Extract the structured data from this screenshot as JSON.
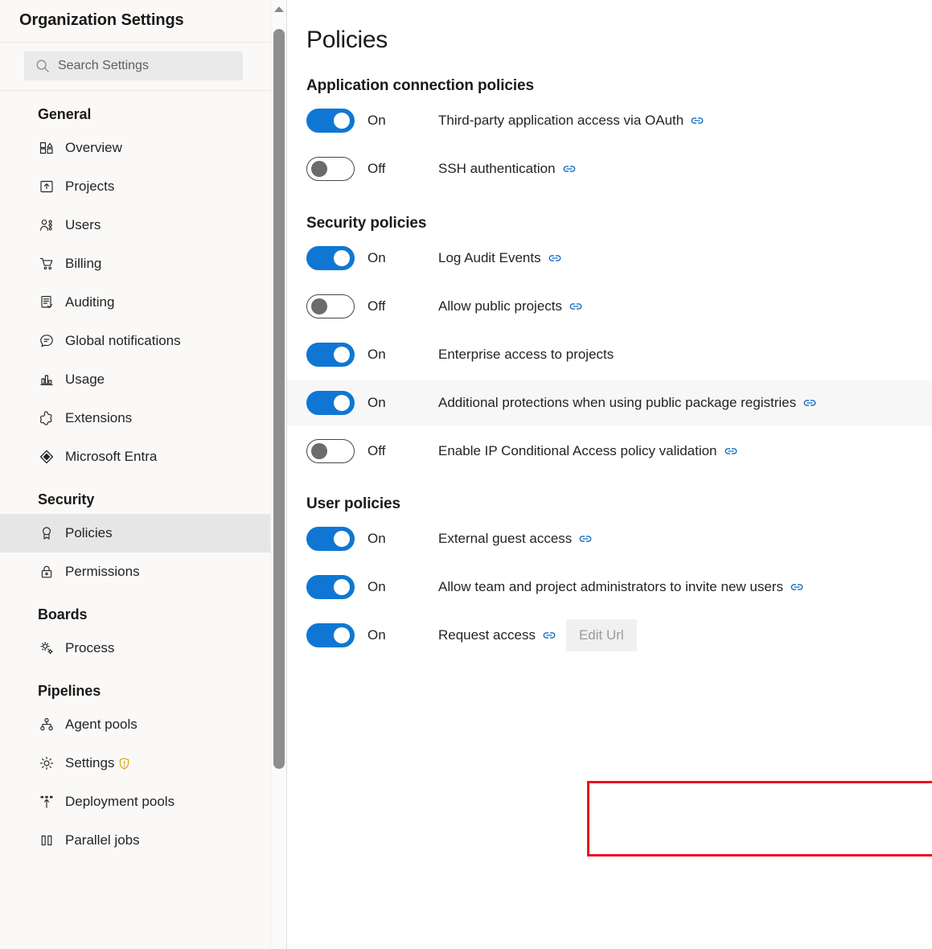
{
  "colors": {
    "accent_blue": "#0f77d3",
    "link_blue": "#0f6cbd",
    "highlight_red": "#e81123",
    "warning_amber": "#d9a300",
    "sidebar_bg": "#faf9f8",
    "selected_bg": "#e6e6e6",
    "hover_row_bg": "#f7f7f7"
  },
  "sidebar": {
    "title": "Organization Settings",
    "search": {
      "placeholder": "Search Settings",
      "value": "",
      "icon": "search-icon"
    },
    "groups": [
      {
        "title": "General",
        "items": [
          {
            "label": "Overview",
            "icon": "overview-icon",
            "selected": false,
            "badge": null
          },
          {
            "label": "Projects",
            "icon": "projects-icon",
            "selected": false,
            "badge": null
          },
          {
            "label": "Users",
            "icon": "users-icon",
            "selected": false,
            "badge": null
          },
          {
            "label": "Billing",
            "icon": "billing-cart-icon",
            "selected": false,
            "badge": null
          },
          {
            "label": "Auditing",
            "icon": "auditing-icon",
            "selected": false,
            "badge": null
          },
          {
            "label": "Global notifications",
            "icon": "notifications-icon",
            "selected": false,
            "badge": null
          },
          {
            "label": "Usage",
            "icon": "usage-chart-icon",
            "selected": false,
            "badge": null
          },
          {
            "label": "Extensions",
            "icon": "extensions-icon",
            "selected": false,
            "badge": null
          },
          {
            "label": "Microsoft Entra",
            "icon": "entra-icon",
            "selected": false,
            "badge": null
          }
        ]
      },
      {
        "title": "Security",
        "items": [
          {
            "label": "Policies",
            "icon": "policies-ribbon-icon",
            "selected": true,
            "badge": null
          },
          {
            "label": "Permissions",
            "icon": "lock-icon",
            "selected": false,
            "badge": null
          }
        ]
      },
      {
        "title": "Boards",
        "items": [
          {
            "label": "Process",
            "icon": "process-gears-icon",
            "selected": false,
            "badge": null
          }
        ]
      },
      {
        "title": "Pipelines",
        "items": [
          {
            "label": "Agent pools",
            "icon": "agent-pools-icon",
            "selected": false,
            "badge": null
          },
          {
            "label": "Settings",
            "icon": "gear-icon",
            "selected": false,
            "badge": "warning-shield-icon"
          },
          {
            "label": "Deployment pools",
            "icon": "deployment-pools-icon",
            "selected": false,
            "badge": null
          },
          {
            "label": "Parallel jobs",
            "icon": "parallel-jobs-icon",
            "selected": false,
            "badge": null
          }
        ]
      }
    ]
  },
  "main": {
    "page_title": "Policies",
    "sections": [
      {
        "title": "Application connection policies",
        "policies": [
          {
            "state": "On",
            "on": true,
            "label": "Third-party application access via OAuth",
            "has_link": true,
            "link_icon": "link-icon",
            "hovered": false,
            "button": null,
            "highlighted": false
          },
          {
            "state": "Off",
            "on": false,
            "label": "SSH authentication",
            "has_link": true,
            "link_icon": "link-icon",
            "hovered": false,
            "button": null,
            "highlighted": false
          }
        ]
      },
      {
        "title": "Security policies",
        "policies": [
          {
            "state": "On",
            "on": true,
            "label": "Log Audit Events",
            "has_link": true,
            "link_icon": "link-icon",
            "hovered": false,
            "button": null,
            "highlighted": false
          },
          {
            "state": "Off",
            "on": false,
            "label": "Allow public projects",
            "has_link": true,
            "link_icon": "link-icon",
            "hovered": false,
            "button": null,
            "highlighted": false
          },
          {
            "state": "On",
            "on": true,
            "label": "Enterprise access to projects",
            "has_link": false,
            "link_icon": null,
            "hovered": false,
            "button": null,
            "highlighted": false
          },
          {
            "state": "On",
            "on": true,
            "label": "Additional protections when using public package registries",
            "has_link": true,
            "link_icon": "link-icon",
            "hovered": true,
            "button": null,
            "highlighted": false
          },
          {
            "state": "Off",
            "on": false,
            "label": "Enable IP Conditional Access policy validation",
            "has_link": true,
            "link_icon": "link-icon",
            "hovered": false,
            "button": null,
            "highlighted": false
          }
        ]
      },
      {
        "title": "User policies",
        "policies": [
          {
            "state": "On",
            "on": true,
            "label": "External guest access",
            "has_link": true,
            "link_icon": "link-icon",
            "hovered": false,
            "button": null,
            "highlighted": false
          },
          {
            "state": "On",
            "on": true,
            "label": "Allow team and project administrators to invite new users",
            "has_link": true,
            "link_icon": "link-icon",
            "hovered": false,
            "button": null,
            "highlighted": true
          },
          {
            "state": "On",
            "on": true,
            "label": "Request access",
            "has_link": true,
            "link_icon": "link-icon",
            "hovered": false,
            "button": "Edit Url",
            "highlighted": false
          }
        ]
      }
    ]
  }
}
